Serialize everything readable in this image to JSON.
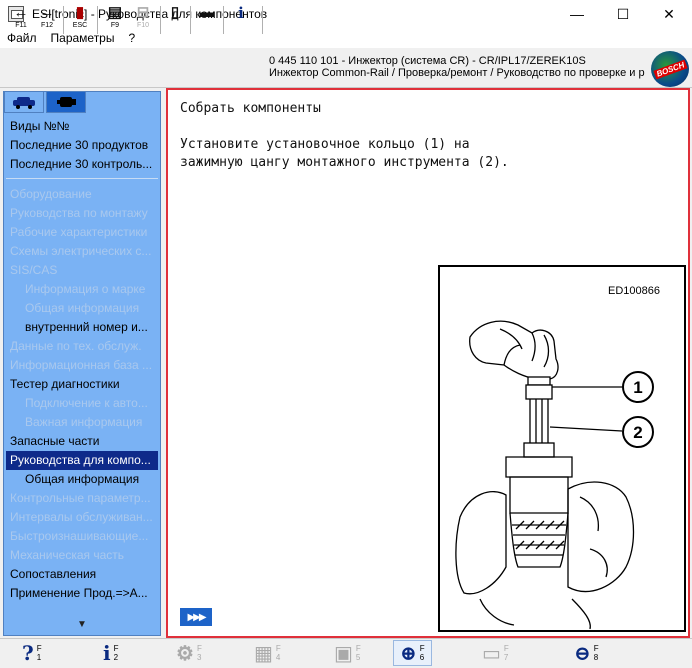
{
  "window": {
    "title": "ESI[tronic] - Руководства для компонентов",
    "minimize": "—",
    "maximize": "☐",
    "close": "✕"
  },
  "menu": [
    "Файл",
    "Параметры",
    "?"
  ],
  "toolbar": {
    "buttons": [
      {
        "name": "back-button",
        "glyph": "←",
        "key": "F11"
      },
      {
        "name": "forward-button",
        "glyph": "→",
        "key": "F12"
      },
      {
        "name": "esc-button",
        "glyph": "▮",
        "key": "ESC"
      },
      {
        "name": "f9-button",
        "glyph": "▤",
        "key": "F9"
      },
      {
        "name": "f10-button",
        "glyph": "⊟",
        "key": "F10"
      },
      {
        "name": "document-button",
        "glyph": "▯",
        "key": ""
      },
      {
        "name": "print-button",
        "glyph": "▬",
        "key": ""
      },
      {
        "name": "info-button",
        "glyph": "i",
        "key": ""
      }
    ],
    "path_line1": "0 445 110 101 - Инжектор (система CR) - CR/IPL17/ZEREK10S",
    "path_line2": "Инжектор Common-Rail / Проверка/ремонт / Руководство по проверке и р",
    "logo_text": "BOSCH"
  },
  "sidebar": {
    "tabs": [
      "car-icon",
      "component-icon"
    ],
    "top_items": [
      "Виды №№",
      "Последние 30 продуктов",
      "Последние 30 контроль..."
    ],
    "items": [
      {
        "label": "Оборудование",
        "state": "dim",
        "indent": false
      },
      {
        "label": "Руководства по монтажу",
        "state": "dim",
        "indent": false
      },
      {
        "label": "Рабочие характеристики",
        "state": "dim",
        "indent": false
      },
      {
        "label": "Схемы электрических с...",
        "state": "dim",
        "indent": false
      },
      {
        "label": "SIS/CAS",
        "state": "dim",
        "indent": false
      },
      {
        "label": "Информация о марке",
        "state": "dim",
        "indent": true
      },
      {
        "label": "Общая информация",
        "state": "dim",
        "indent": true
      },
      {
        "label": "внутренний номер и...",
        "state": "active",
        "indent": true
      },
      {
        "label": "Данные по тех. обслуж.",
        "state": "dim",
        "indent": false
      },
      {
        "label": "Информационная база ...",
        "state": "dim",
        "indent": false
      },
      {
        "label": "Тестер диагностики",
        "state": "active",
        "indent": false
      },
      {
        "label": "Подключение к авто...",
        "state": "dim",
        "indent": true
      },
      {
        "label": "Важная информация",
        "state": "dim",
        "indent": true
      },
      {
        "label": "Запасные части",
        "state": "active",
        "indent": false
      },
      {
        "label": "Руководства для компо...",
        "state": "selected",
        "indent": false
      },
      {
        "label": "Общая информация",
        "state": "active",
        "indent": true
      },
      {
        "label": "Контрольные параметр...",
        "state": "dim",
        "indent": false
      },
      {
        "label": "Интервалы обслуживан...",
        "state": "dim",
        "indent": false
      },
      {
        "label": "Быстроизнашивающие...",
        "state": "dim",
        "indent": false
      },
      {
        "label": "Механическая часть",
        "state": "dim",
        "indent": false
      },
      {
        "label": "Сопоставления",
        "state": "active",
        "indent": false
      },
      {
        "label": "Применение Прод.=>А...",
        "state": "active",
        "indent": false
      }
    ],
    "scroll_glyph": "▼"
  },
  "content": {
    "heading": "Собрать компоненты",
    "line1": "Установите установочное кольцо (1) на",
    "line2": "зажимную цангу монтажного инструмента (2).",
    "figure_code": "ED100866",
    "callout1": "1",
    "callout2": "2",
    "next_glyph": "▶▶▶"
  },
  "fkeys": [
    {
      "name": "help-f1",
      "glyph": "?",
      "label": "F\n1",
      "state": "normal"
    },
    {
      "name": "info-f2",
      "glyph": "i",
      "label": "F\n2",
      "state": "normal"
    },
    {
      "name": "f3-key",
      "glyph": "⚙",
      "label": "F\n3",
      "state": "disabled"
    },
    {
      "name": "f4-key",
      "glyph": "▦",
      "label": "F\n4",
      "state": "disabled"
    },
    {
      "name": "f5-key",
      "glyph": "▣",
      "label": "F\n5",
      "state": "disabled"
    },
    {
      "name": "zoom-f6",
      "glyph": "⊕",
      "label": "F\n6",
      "state": "on"
    },
    {
      "name": "f7-key",
      "glyph": "▭",
      "label": "F\n7",
      "state": "disabled"
    },
    {
      "name": "bosch-f8",
      "glyph": "⊖",
      "label": "F\n8",
      "state": "normal"
    }
  ]
}
